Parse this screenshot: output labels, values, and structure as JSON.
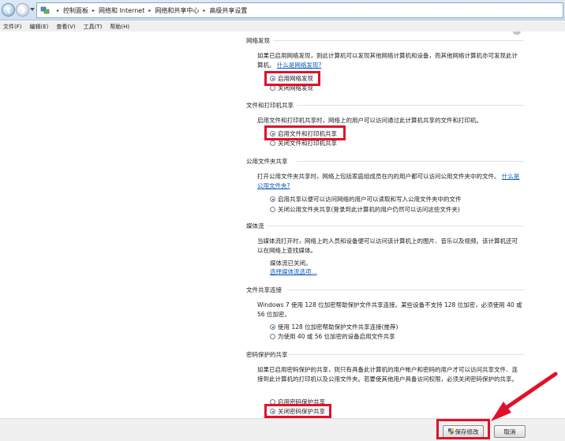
{
  "address": {
    "crumbs": [
      "控制面板",
      "网络和 Internet",
      "网络和共享中心",
      "高级共享设置"
    ]
  },
  "menu": [
    "文件(F)",
    "编辑(E)",
    "查看(V)",
    "工具(T)",
    "帮助(H)"
  ],
  "sections": {
    "discovery": {
      "title": "网络发现",
      "desc": "如果已启用网络发现，则此计算机可以发现其他网络计算机和设备，而其他网络计算机亦可发现此计算机。",
      "link": "什么是网络发现?",
      "options": [
        "启用网络发现",
        "关闭网络发现"
      ],
      "selected": 0
    },
    "fileprint": {
      "title": "文件和打印机共享",
      "desc": "启用文件和打印机共享时，网络上的用户可以访问通过此计算机共享的文件和打印机。",
      "options": [
        "启用文件和打印机共享",
        "关闭文件和打印机共享"
      ],
      "selected": 0
    },
    "public": {
      "title": "公用文件夹共享",
      "desc": "打开公用文件夹共享时，网络上包括家庭组成员在内的用户都可以访问公用文件夹中的文件。",
      "link": "什么是公用文件夹?",
      "options": [
        "启用共享以便可以访问网络的用户可以读取和写入公用文件夹中的文件",
        "关闭公用文件夹共享(登录到此计算机的用户仍然可以访问这些文件夹)"
      ],
      "selected": 0
    },
    "media": {
      "title": "媒体流",
      "desc": "当媒体流打开时，网络上的人员和设备便可以访问该计算机上的图片、音乐以及视频。该计算机还可以在网络上查找媒体。",
      "status": "媒体流已关闭。",
      "link": "选择媒体流选项..."
    },
    "connection": {
      "title": "文件共享连接",
      "desc": "Windows 7 使用 128 位加密帮助保护文件共享连接。某些设备不支持 128 位加密，必须使用 40 或 56 位加密。",
      "options": [
        "使用 128 位加密帮助保护文件共享连接(推荐)",
        "为使用 40 或 56 位加密的设备启用文件共享"
      ],
      "selected": 0
    },
    "password": {
      "title": "密码保护的共享",
      "desc": "如果已启用密码保护的共享，则只有具备此计算机的用户帐户和密码的用户才可以访问共享文件、连接到此计算机的打印机以及公用文件夹。若要使其他用户具备访问权限，必须关闭密码保护的共享。",
      "options": [
        "启用密码保护共享",
        "关闭密码保护共享"
      ],
      "selected": 1
    }
  },
  "buttons": {
    "save": "保存修改",
    "cancel": "取消"
  },
  "colors": {
    "highlight": "#e2102a",
    "link": "#0b57c2"
  }
}
